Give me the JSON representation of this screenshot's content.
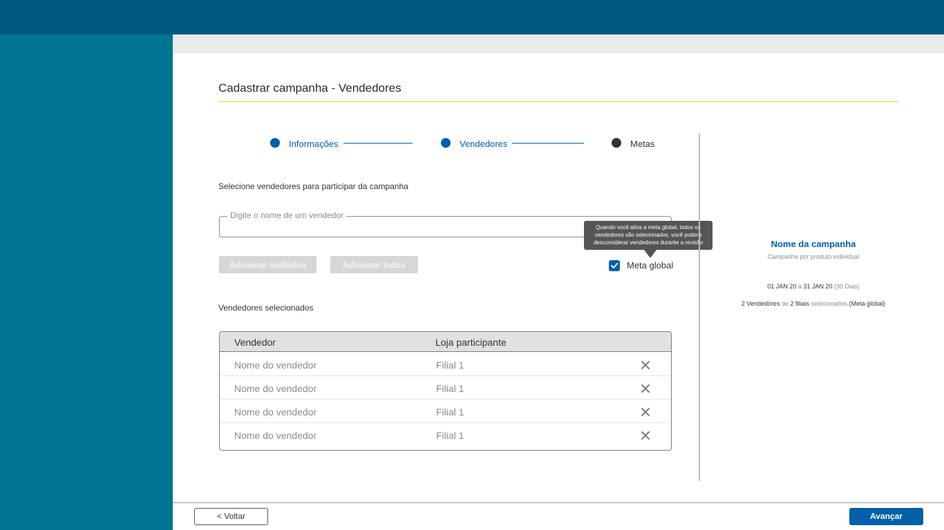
{
  "page": {
    "title": "Cadastrar campanha - Vendedores"
  },
  "colors": {
    "topbar": "#005a80",
    "sidebar": "#007593",
    "primary": "#0060a8",
    "title_rule": "#efe68a"
  },
  "stepper": {
    "steps": [
      {
        "label": "Informações",
        "state": "done"
      },
      {
        "label": "Vendedores",
        "state": "current"
      },
      {
        "label": "Metas",
        "state": "pending"
      }
    ]
  },
  "form": {
    "instruction": "Selecione vendedores para participar da campanha",
    "search_placeholder": "Digite o nome de um vendedor",
    "search_value": "",
    "add_multiple_label": "Adicionar múltiplos",
    "add_all_label": "Adicionar todos",
    "global_goal_label": "Meta global",
    "global_goal_checked": true,
    "tooltip": "Quando você ativa a meta global, todos os vendedores são selecionados, você poderá desconsiderar vendedores durante a revisão"
  },
  "selected": {
    "title": "Vendedores selecionados",
    "columns": [
      "Vendedor",
      "Loja participante"
    ],
    "rows": [
      {
        "vendor": "Nome do vendedor",
        "store": "Filial 1"
      },
      {
        "vendor": "Nome do vendedor",
        "store": "Filial 1"
      },
      {
        "vendor": "Nome do vendedor",
        "store": "Filial 1"
      },
      {
        "vendor": "Nome do vendedor",
        "store": "Filial 1"
      }
    ],
    "remove_icon": "close-icon"
  },
  "summary": {
    "campaign_name": "Nome da campanha",
    "campaign_type": "Campanha por produto individual",
    "start_date": "01 JAN 20",
    "date_separator": "à",
    "end_date": "31 JAN 20",
    "duration": "(30 Dias)",
    "vendor_count": "2 Vendedores",
    "of_word": "de",
    "branch_count": "2 filiais",
    "selected_word": "selecionados",
    "goal_mode": "(Meta global)"
  },
  "footer": {
    "back_label": "< Voltar",
    "next_label": "Avançar"
  }
}
